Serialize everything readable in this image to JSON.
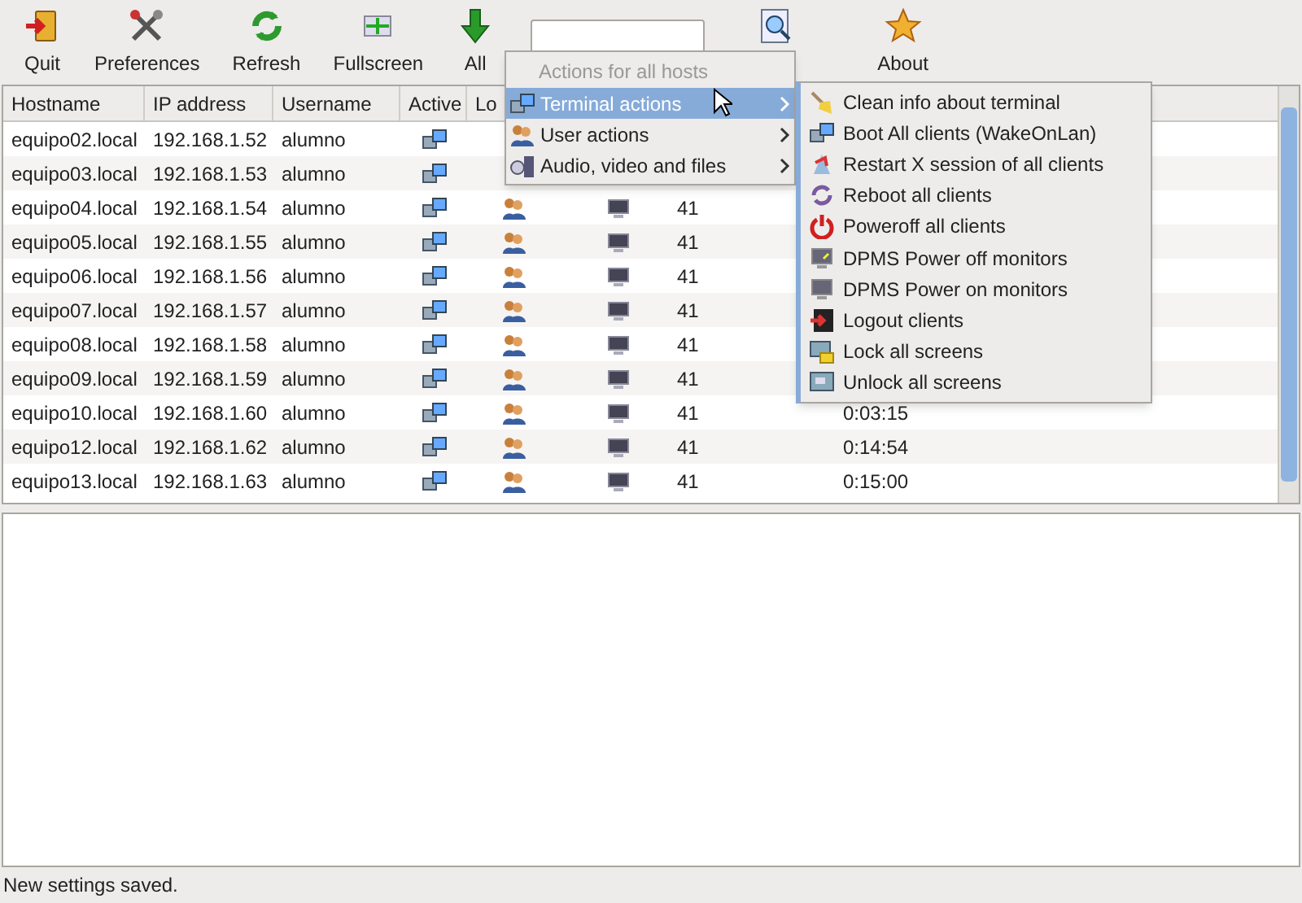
{
  "toolbar": [
    {
      "kind": "quit",
      "label": "Quit"
    },
    {
      "kind": "preferences",
      "label": "Preferences"
    },
    {
      "kind": "refresh",
      "label": "Refresh"
    },
    {
      "kind": "fullscreen",
      "label": "Fullscreen"
    },
    {
      "kind": "all-hosts",
      "label": "All"
    },
    {
      "kind": "search-field"
    },
    {
      "kind": "find"
    },
    {
      "kind": "about",
      "label": "About"
    }
  ],
  "table": {
    "columns": [
      "Hostname",
      "IP address",
      "Username",
      "Active",
      "Lo"
    ],
    "rows": [
      {
        "hostname": "equipo02.local",
        "ip": "192.168.1.52",
        "username": "alumno",
        "active": true
      },
      {
        "hostname": "equipo03.local",
        "ip": "192.168.1.53",
        "username": "alumno",
        "active": true
      },
      {
        "hostname": "equipo04.local",
        "ip": "192.168.1.54",
        "username": "alumno",
        "active": true,
        "logged_in": true,
        "monitor": true,
        "count": "41"
      },
      {
        "hostname": "equipo05.local",
        "ip": "192.168.1.55",
        "username": "alumno",
        "active": true,
        "logged_in": true,
        "monitor": true,
        "count": "41"
      },
      {
        "hostname": "equipo06.local",
        "ip": "192.168.1.56",
        "username": "alumno",
        "active": true,
        "logged_in": true,
        "monitor": true,
        "count": "41"
      },
      {
        "hostname": "equipo07.local",
        "ip": "192.168.1.57",
        "username": "alumno",
        "active": true,
        "logged_in": true,
        "monitor": true,
        "count": "41"
      },
      {
        "hostname": "equipo08.local",
        "ip": "192.168.1.58",
        "username": "alumno",
        "active": true,
        "logged_in": true,
        "monitor": true,
        "count": "41"
      },
      {
        "hostname": "equipo09.local",
        "ip": "192.168.1.59",
        "username": "alumno",
        "active": true,
        "logged_in": true,
        "monitor": true,
        "count": "41"
      },
      {
        "hostname": "equipo10.local",
        "ip": "192.168.1.60",
        "username": "alumno",
        "active": true,
        "logged_in": true,
        "monitor": true,
        "count": "41",
        "time": "0:03:15"
      },
      {
        "hostname": "equipo12.local",
        "ip": "192.168.1.62",
        "username": "alumno",
        "active": true,
        "logged_in": true,
        "monitor": true,
        "count": "41",
        "time": "0:14:54"
      },
      {
        "hostname": "equipo13.local",
        "ip": "192.168.1.63",
        "username": "alumno",
        "active": true,
        "logged_in": true,
        "monitor": true,
        "count": "41",
        "time": "0:15:00"
      }
    ]
  },
  "menu": {
    "title": "Actions for all hosts",
    "items": [
      {
        "kind": "terminal",
        "label": "Terminal actions",
        "selected": true
      },
      {
        "kind": "users",
        "label": "User actions",
        "selected": false
      },
      {
        "kind": "media",
        "label": "Audio, video and files",
        "selected": false
      }
    ]
  },
  "submenu": {
    "items": [
      {
        "kind": "broom",
        "label": "Clean info about terminal"
      },
      {
        "kind": "network",
        "label": "Boot All clients (WakeOnLan)"
      },
      {
        "kind": "restart",
        "label": "Restart X session of all clients"
      },
      {
        "kind": "reboot",
        "label": "Reboot all clients"
      },
      {
        "kind": "power",
        "label": "Poweroff all clients"
      },
      {
        "kind": "monitor-off",
        "label": "DPMS Power off monitors"
      },
      {
        "kind": "monitor-on",
        "label": "DPMS Power on monitors"
      },
      {
        "kind": "logout",
        "label": "Logout clients"
      },
      {
        "kind": "lock",
        "label": "Lock all screens"
      },
      {
        "kind": "unlock",
        "label": "Unlock all screens"
      }
    ]
  },
  "status_bar": "New settings saved."
}
